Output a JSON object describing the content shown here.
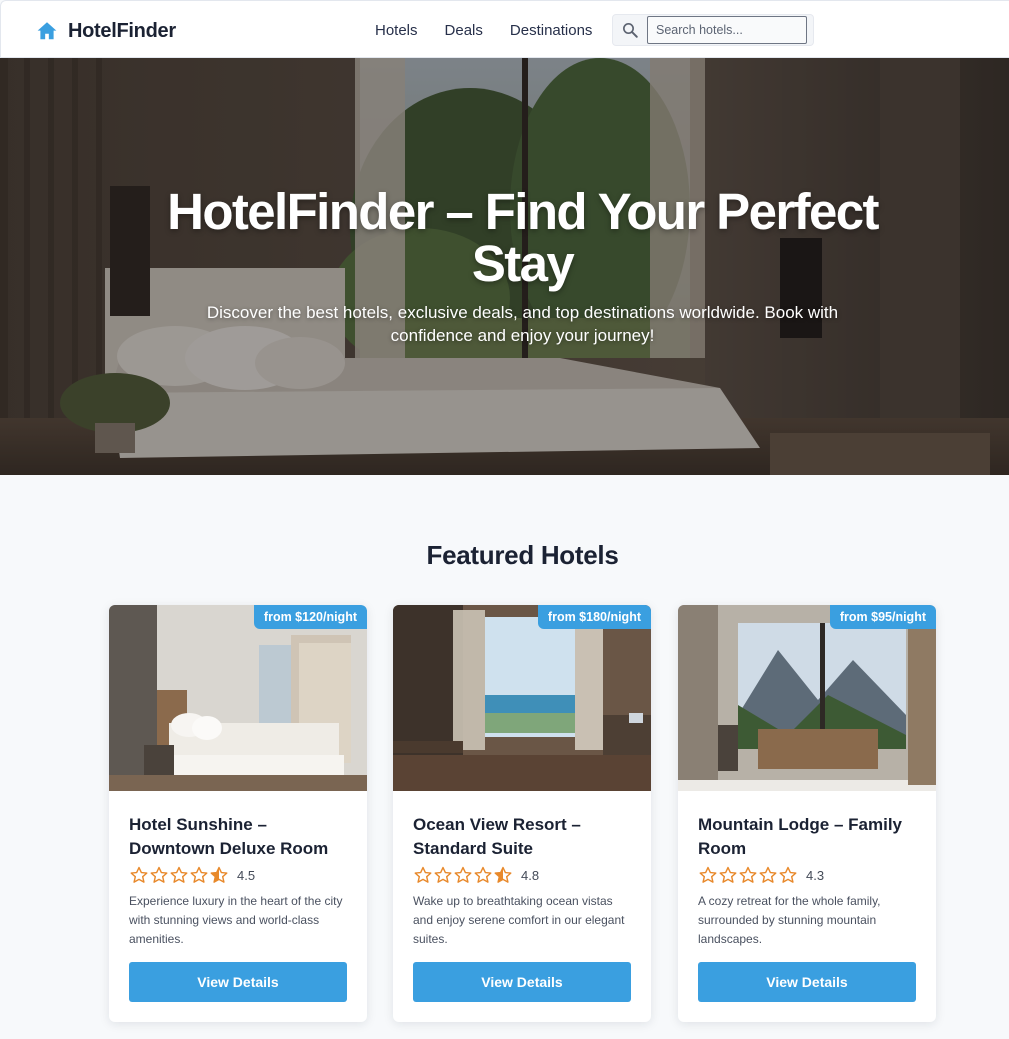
{
  "brand": {
    "name": "HotelFinder",
    "icon": "home-icon",
    "accent": "#3a9fe0"
  },
  "nav": {
    "links": [
      "Hotels",
      "Deals",
      "Destinations"
    ],
    "search": {
      "placeholder": "Search hotels...",
      "icon": "search-icon"
    }
  },
  "hero": {
    "title": "HotelFinder – Find Your Perfect Stay",
    "subtitle": "Discover the best hotels, exclusive deals, and top destinations worldwide. Book with confidence and enjoy your journey!"
  },
  "featured": {
    "title": "Featured Hotels",
    "hotels": [
      {
        "name": "Hotel Sunshine – Downtown Deluxe Room",
        "price": "from $120/night",
        "rating": 4.5,
        "rating_label": "4.5",
        "description": "Experience luxury in the heart of the city with stunning views and world-class amenities.",
        "button": "View Details"
      },
      {
        "name": "Ocean View Resort – Standard Suite",
        "price": "from $180/night",
        "rating": 4.8,
        "rating_label": "4.8",
        "description": "Wake up to breathtaking ocean vistas and enjoy serene comfort in our elegant suites.",
        "button": "View Details"
      },
      {
        "name": "Mountain Lodge – Family Room",
        "price": "from $95/night",
        "rating": 4.3,
        "rating_label": "4.3",
        "description": "A cozy retreat for the whole family, surrounded by stunning mountain landscapes.",
        "button": "View Details"
      }
    ]
  },
  "colors": {
    "accent": "#3a9fe0",
    "star": "#e8892b",
    "text": "#1b2233",
    "background": "#f7f9fb"
  }
}
